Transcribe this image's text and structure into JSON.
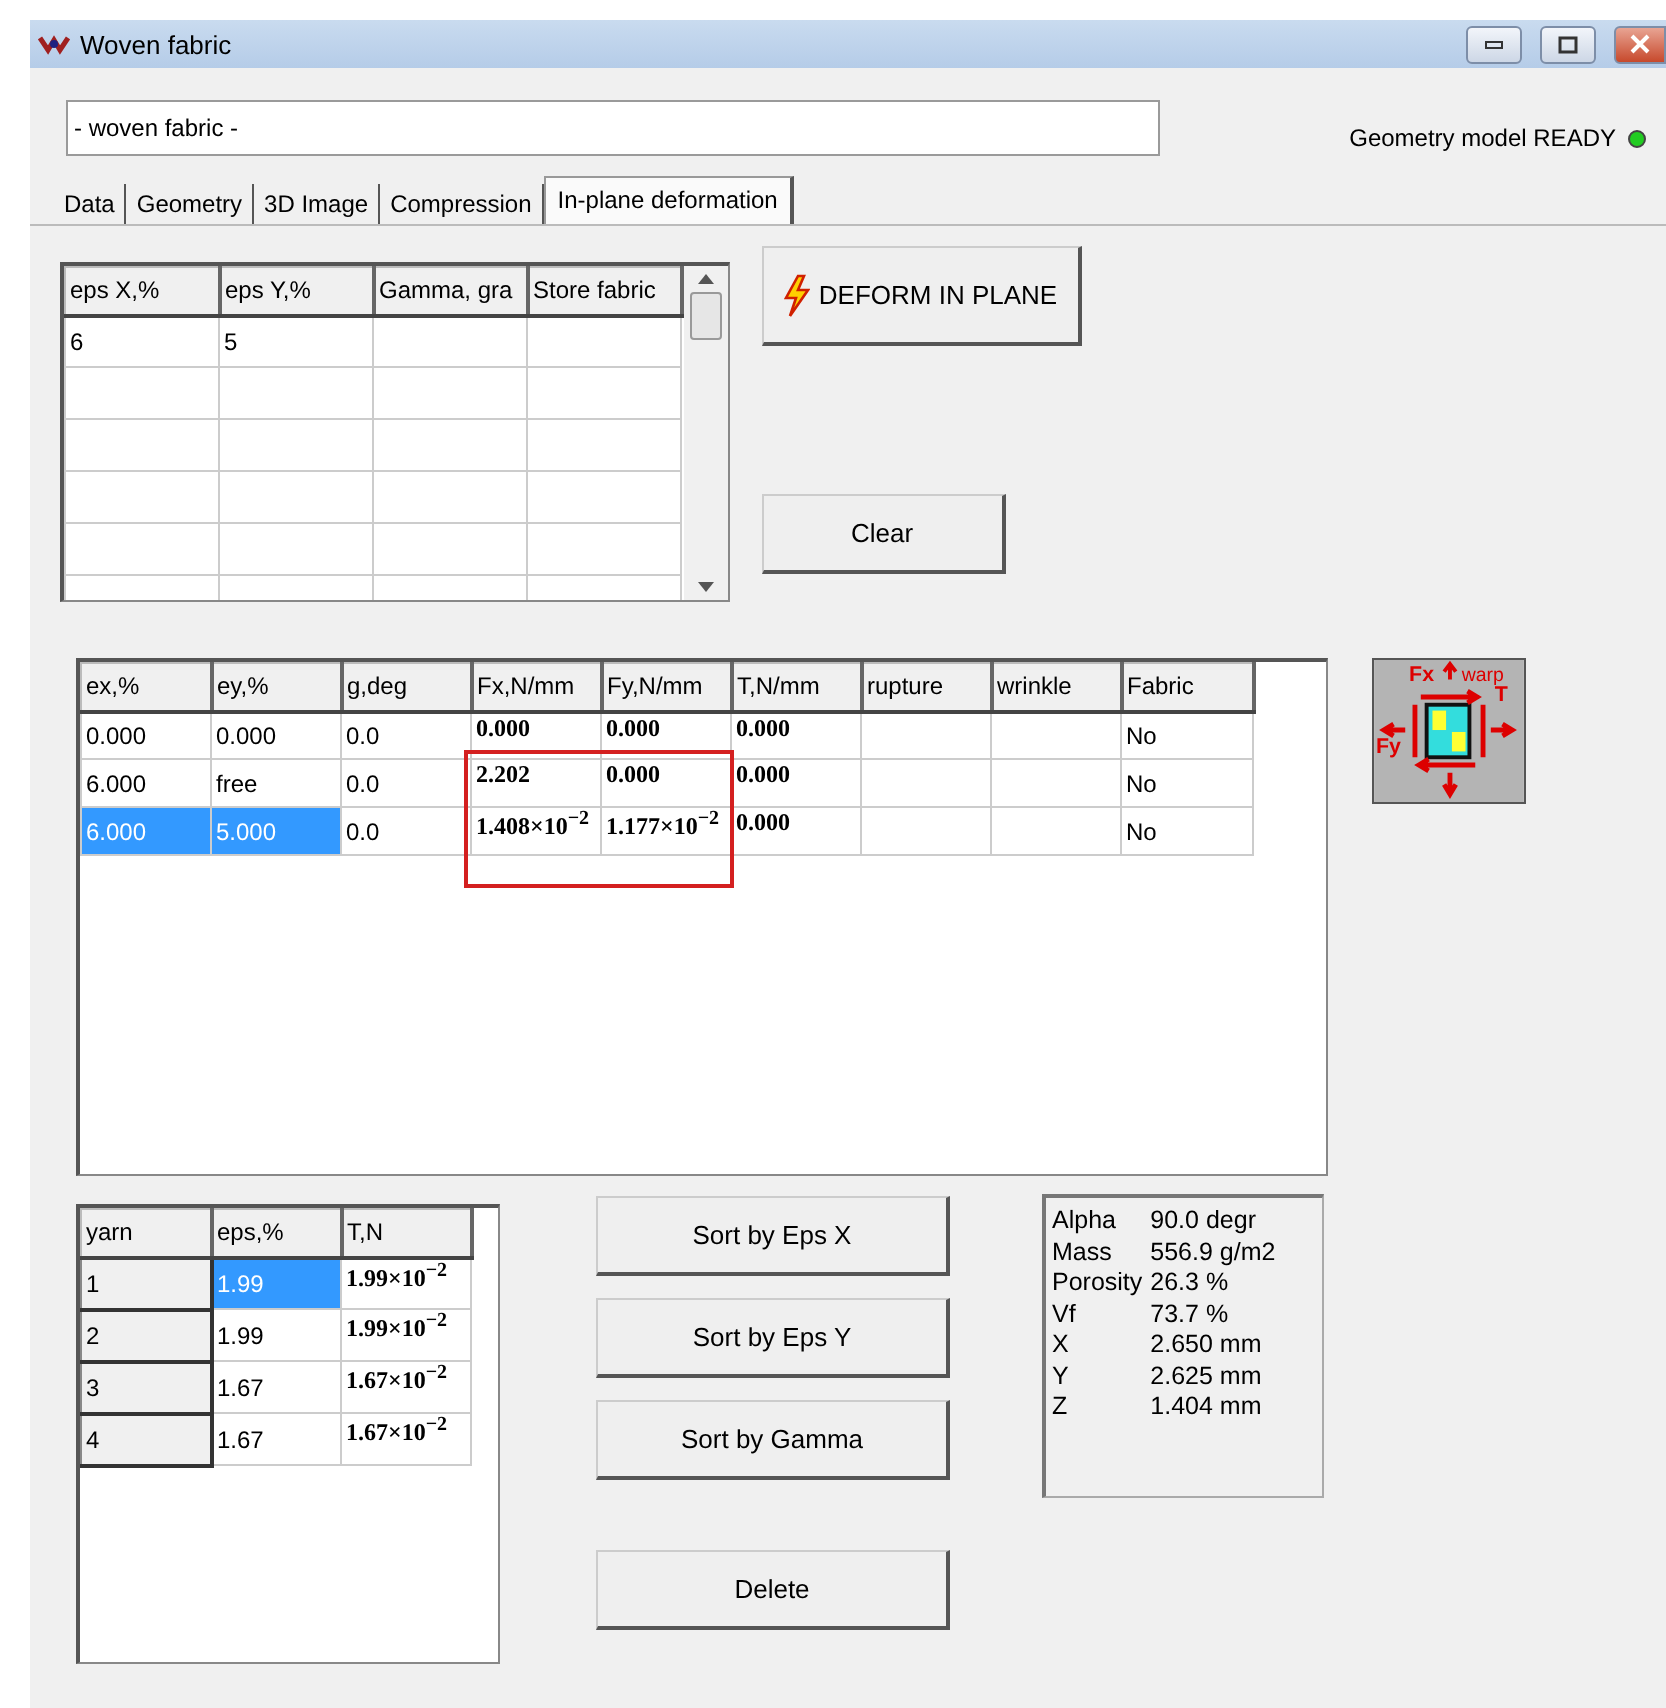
{
  "window": {
    "title": "Woven fabric"
  },
  "name_field": {
    "value": "- woven fabric -"
  },
  "status": {
    "text": "Geometry model READY",
    "on": true
  },
  "tabs": [
    {
      "label": "Data",
      "selected": false
    },
    {
      "label": "Geometry",
      "selected": false
    },
    {
      "label": "3D Image",
      "selected": false
    },
    {
      "label": "Compression",
      "selected": false
    },
    {
      "label": "In-plane deformation",
      "selected": true
    }
  ],
  "input_table": {
    "columns": [
      "eps X,%",
      "eps Y,%",
      "Gamma, gra",
      "Store fabric"
    ],
    "rows": [
      [
        "6",
        "5"
      ]
    ]
  },
  "deform_button": {
    "label": "DEFORM IN PLANE"
  },
  "clear_button": {
    "label": "Clear"
  },
  "results_table": {
    "columns": [
      {
        "label": "ex,%",
        "kind": "plain"
      },
      {
        "label": "ey,%",
        "kind": "plain"
      },
      {
        "label": "g,deg",
        "kind": "plain"
      },
      {
        "label": "Fx,N/mm",
        "kind": "force"
      },
      {
        "label": "Fy,N/mm",
        "kind": "force"
      },
      {
        "label": "T,N/mm",
        "kind": "force"
      },
      {
        "label": "rupture"
      },
      {
        "label": "wrinkle"
      },
      {
        "label": "Fabric",
        "kind": "plain"
      }
    ],
    "rows": [
      [
        {
          "text": "0.000",
          "selected": false
        },
        {
          "text": "0.000",
          "selected": false
        },
        {
          "text": "0.0",
          "selected": false
        },
        {
          "text": "0.000",
          "selected": false
        },
        {
          "text": "0.000",
          "selected": false
        },
        {
          "text": "0.000",
          "selected": false
        },
        null,
        null,
        {
          "text": "No",
          "selected": false
        }
      ],
      [
        {
          "text": "6.000",
          "selected": false
        },
        {
          "text": "free",
          "selected": false
        },
        {
          "text": "0.0",
          "selected": false
        },
        {
          "text": "2.202",
          "selected": false
        },
        {
          "text": "0.000",
          "selected": false
        },
        {
          "text": "0.000",
          "selected": false
        },
        null,
        null,
        {
          "text": "No",
          "selected": false
        }
      ],
      [
        {
          "text": "6.000",
          "selected": true
        },
        {
          "text": "5.000",
          "selected": true
        },
        {
          "text": "0.0",
          "selected": false
        },
        {
          "text": "1.408×10$^{−2}$",
          "selected": false
        },
        {
          "text": "1.177×10$^{−2}$",
          "selected": false
        },
        {
          "text": "0.000",
          "selected": false
        },
        null,
        null,
        {
          "text": "No",
          "selected": false
        }
      ]
    ]
  },
  "diagram": {
    "labels": [
      "Fx",
      "warp",
      "T",
      "Fy"
    ]
  },
  "yarn_table": {
    "columns": [
      {
        "label": "yarn",
        "kind": "header"
      },
      {
        "label": "eps,%",
        "kind": "plain"
      },
      {
        "label": "T,N",
        "kind": "force"
      }
    ],
    "rows": [
      [
        {
          "text": "1",
          "selected": false
        },
        {
          "text": "1.99",
          "selected": true
        },
        {
          "text": "1.99×10$^{−2}$",
          "selected": false
        }
      ],
      [
        {
          "text": "2",
          "selected": false
        },
        {
          "text": "1.99",
          "selected": false
        },
        {
          "text": "1.99×10$^{−2}$",
          "selected": false
        }
      ],
      [
        {
          "text": "3",
          "selected": false
        },
        {
          "text": "1.67",
          "selected": false
        },
        {
          "text": "1.67×10$^{−2}$",
          "selected": false
        }
      ],
      [
        {
          "text": "4",
          "selected": false
        },
        {
          "text": "1.67",
          "selected": false
        },
        {
          "text": "1.67×10$^{−2}$",
          "selected": false
        }
      ]
    ]
  },
  "sort_buttons": [
    "Sort by Eps X",
    "Sort by Eps Y",
    "Sort by Gamma"
  ],
  "delete_button": {
    "label": "Delete"
  },
  "properties": [
    {
      "label": "Alpha",
      "value": "90.0 degr"
    },
    {
      "label": "Mass",
      "value": "556.9 g/m2"
    },
    {
      "label": "Porosity",
      "value": "26.3 %"
    },
    {
      "label": "Vf",
      "value": "73.7 %"
    },
    {
      "label": "X",
      "value": "2.650 mm"
    },
    {
      "label": "Y",
      "value": "2.625 mm"
    },
    {
      "label": "Z",
      "value": "1.404 mm"
    }
  ]
}
